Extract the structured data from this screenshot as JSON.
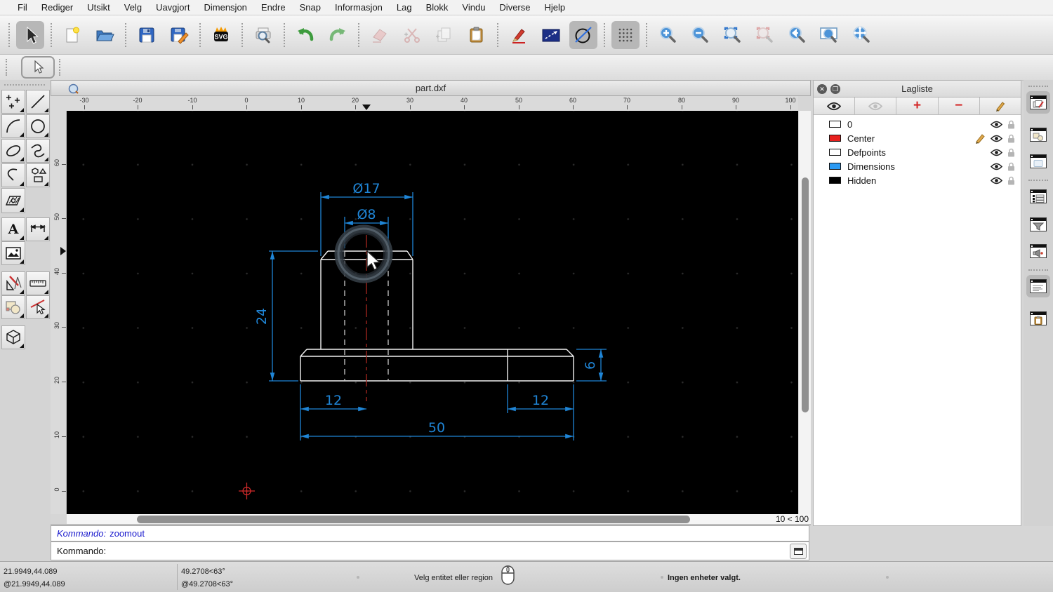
{
  "menu": {
    "items": [
      "Fil",
      "Rediger",
      "Utsikt",
      "Velg",
      "Uavgjort",
      "Dimensjon",
      "Endre",
      "Snap",
      "Informasjon",
      "Lag",
      "Blokk",
      "Vindu",
      "Diverse",
      "Hjelp"
    ]
  },
  "toolbar": {
    "svg_badge": "SVG",
    "buttons": [
      "select-pointer",
      "new-document",
      "open-file",
      "save",
      "save-as",
      "export-svg",
      "print-preview",
      "undo",
      "redo",
      "delete",
      "cut",
      "copy",
      "paste",
      "draw-pen",
      "line-attributes",
      "circle-with-line",
      "grid-toggle",
      "zoom-in",
      "zoom-out",
      "zoom-auto",
      "zoom-selection",
      "zoom-previous",
      "zoom-window",
      "zoom-pan"
    ]
  },
  "tool_options": {
    "buttons": [
      "select-pointer"
    ]
  },
  "palette": {
    "text_tool_glyph": "A",
    "buttons": [
      "points",
      "line",
      "arc",
      "circle",
      "ellipse",
      "spline",
      "polyline",
      "polygon-shapes",
      "hatch",
      "text",
      "dimension",
      "image",
      "construction",
      "measure",
      "blocks",
      "select-entity",
      "cube-3d"
    ]
  },
  "window": {
    "title": "part.dxf"
  },
  "rulers": {
    "h_labels": [
      "-30",
      "-20",
      "-10",
      "0",
      "10",
      "20",
      "30",
      "40",
      "50",
      "60",
      "70",
      "80",
      "90",
      "100"
    ],
    "v_labels": [
      "60",
      "50",
      "40",
      "30",
      "20",
      "10",
      "0"
    ]
  },
  "drawing": {
    "dimensions": {
      "outer_diameter": "Ø17",
      "hole_diameter": "Ø8",
      "boss_height": "24",
      "base_thickness": "6",
      "left_offset": "12",
      "right_offset": "12",
      "total_width": "50"
    },
    "colors": {
      "outline": "#f2f2f2",
      "hidden": "#c9c9c9",
      "centerline": "#9a241c",
      "dimension": "#1f85d6"
    }
  },
  "grid_status": "10 < 100",
  "command": {
    "history_label": "Kommando:",
    "history_value": "zoomout",
    "prompt_label": "Kommando:"
  },
  "layer_panel": {
    "title": "Lagliste",
    "toolbar": [
      "show-all-layers",
      "hide-all-layers",
      "add-layer",
      "remove-layer",
      "edit-layer"
    ],
    "add_glyph": "+",
    "remove_glyph": "−",
    "layers": [
      {
        "name": "0",
        "color": "#ffffff"
      },
      {
        "name": "Center",
        "color": "#e8201e"
      },
      {
        "name": "Defpoints",
        "color": "#ffffff"
      },
      {
        "name": "Dimensions",
        "color": "#2b9af3"
      },
      {
        "name": "Hidden",
        "color": "#000000"
      }
    ]
  },
  "right_dock": {
    "buttons": [
      "layer-list-dock",
      "block-list-dock",
      "library-browser-dock",
      "entity-list-dock",
      "selection-filter-dock",
      "view-dock",
      "command-widget-dock",
      "clipboard-dock"
    ]
  },
  "status_bar": {
    "abs_position": "21.9949,44.089",
    "rel_position": "@21.9949,44.089",
    "abs_polar": "49.2708<63°",
    "rel_polar": "@49.2708<63°",
    "hint": "Velg entitet eller region",
    "selection_info": "Ingen enheter valgt."
  }
}
